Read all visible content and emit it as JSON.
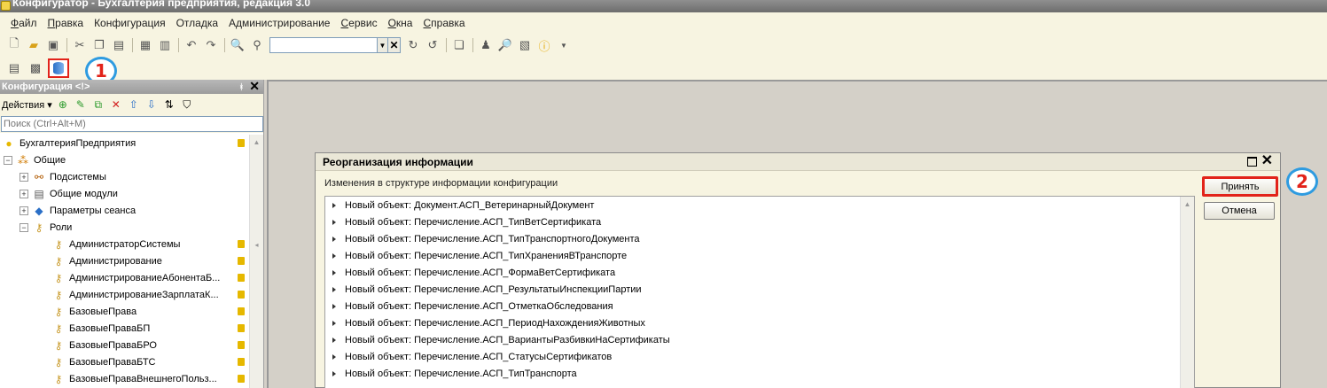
{
  "window": {
    "title": "Конфигуратор - Бухгалтерия предприятия, редакция 3.0"
  },
  "menu": [
    {
      "u": "Ф",
      "rest": "айл"
    },
    {
      "u": "П",
      "rest": "равка"
    },
    {
      "u": "",
      "rest": "Конфигурация"
    },
    {
      "u": "",
      "rest": "Отладка"
    },
    {
      "u": "",
      "rest": "Администрирование"
    },
    {
      "u": "С",
      "rest": "ервис"
    },
    {
      "u": "О",
      "rest": "кна"
    },
    {
      "u": "С",
      "rest": "правка"
    }
  ],
  "callouts": {
    "one": "1",
    "two": "2"
  },
  "left_panel": {
    "title": "Конфигурация <!>",
    "actions_label": "Действия",
    "search_placeholder": "Поиск (Ctrl+Alt+M)",
    "tree": [
      {
        "label": "БухгалтерияПредприятия",
        "level": 0,
        "icon": "config-icon",
        "exp": "",
        "lock": true
      },
      {
        "label": "Общие",
        "level": 1,
        "icon": "common-icon",
        "exp": "−",
        "lock": false
      },
      {
        "label": "Подсистемы",
        "level": 2,
        "icon": "subsystems-icon",
        "exp": "+",
        "lock": false
      },
      {
        "label": "Общие модули",
        "level": 2,
        "icon": "module-icon",
        "exp": "+",
        "lock": false
      },
      {
        "label": "Параметры сеанса",
        "level": 2,
        "icon": "session-icon",
        "exp": "+",
        "lock": false
      },
      {
        "label": "Роли",
        "level": 2,
        "icon": "role-icon",
        "exp": "−",
        "lock": false
      },
      {
        "label": "АдминистраторСистемы",
        "level": 3,
        "icon": "role-icon",
        "exp": "",
        "lock": true
      },
      {
        "label": "Администрирование",
        "level": 3,
        "icon": "role-icon",
        "exp": "",
        "lock": true
      },
      {
        "label": "АдминистрированиеАбонентаБ...",
        "level": 3,
        "icon": "role-icon",
        "exp": "",
        "lock": true
      },
      {
        "label": "АдминистрированиеЗарплатаК...",
        "level": 3,
        "icon": "role-icon",
        "exp": "",
        "lock": true
      },
      {
        "label": "БазовыеПрава",
        "level": 3,
        "icon": "role-icon",
        "exp": "",
        "lock": true
      },
      {
        "label": "БазовыеПраваБП",
        "level": 3,
        "icon": "role-icon",
        "exp": "",
        "lock": true
      },
      {
        "label": "БазовыеПраваБРО",
        "level": 3,
        "icon": "role-icon",
        "exp": "",
        "lock": true
      },
      {
        "label": "БазовыеПраваБТС",
        "level": 3,
        "icon": "role-icon",
        "exp": "",
        "lock": true
      },
      {
        "label": "БазовыеПраваВнешнегоПольз...",
        "level": 3,
        "icon": "role-icon",
        "exp": "",
        "lock": true
      }
    ]
  },
  "dialog": {
    "title": "Реорганизация информации",
    "caption": "Изменения в структуре информации конфигурации",
    "accept_label": "Принять",
    "cancel_label": "Отмена",
    "items": [
      "Новый объект: Документ.АСП_ВетеринарныйДокумент",
      "Новый объект: Перечисление.АСП_ТипВетСертификата",
      "Новый объект: Перечисление.АСП_ТипТранспортногоДокумента",
      "Новый объект: Перечисление.АСП_ТипХраненияВТранспорте",
      "Новый объект: Перечисление.АСП_ФормаВетСертификата",
      "Новый объект: Перечисление.АСП_РезультатыИнспекцииПартии",
      "Новый объект: Перечисление.АСП_ОтметкаОбследования",
      "Новый объект: Перечисление.АСП_ПериодНахожденияЖивотных",
      "Новый объект: Перечисление.АСП_ВариантыРазбивкиНаСертификаты",
      "Новый объект: Перечисление.АСП_СтатусыСертификатов",
      "Новый объект: Перечисление.АСП_ТипТранспорта"
    ]
  },
  "colors": {
    "highlight": "#e2231a",
    "callout_ring": "#2e9be0",
    "panel_bg": "#f7f4e1"
  }
}
